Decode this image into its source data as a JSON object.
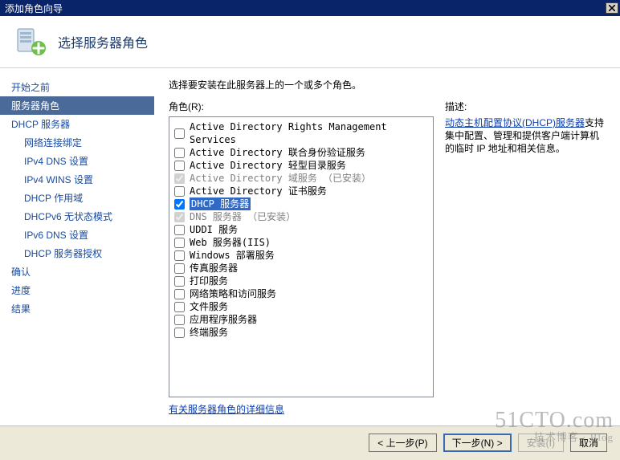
{
  "window": {
    "title": "添加角色向导"
  },
  "header": {
    "title": "选择服务器角色"
  },
  "sidebar": {
    "items": [
      {
        "label": "开始之前",
        "indent": false,
        "active": false
      },
      {
        "label": "服务器角色",
        "indent": false,
        "active": true
      },
      {
        "label": "DHCP 服务器",
        "indent": false,
        "active": false
      },
      {
        "label": "网络连接绑定",
        "indent": true,
        "active": false
      },
      {
        "label": "IPv4 DNS 设置",
        "indent": true,
        "active": false
      },
      {
        "label": "IPv4 WINS 设置",
        "indent": true,
        "active": false
      },
      {
        "label": "DHCP 作用域",
        "indent": true,
        "active": false
      },
      {
        "label": "DHCPv6 无状态模式",
        "indent": true,
        "active": false
      },
      {
        "label": "IPv6 DNS 设置",
        "indent": true,
        "active": false
      },
      {
        "label": "DHCP 服务器授权",
        "indent": true,
        "active": false
      },
      {
        "label": "确认",
        "indent": false,
        "active": false
      },
      {
        "label": "进度",
        "indent": false,
        "active": false
      },
      {
        "label": "结果",
        "indent": false,
        "active": false
      }
    ]
  },
  "main": {
    "instruction": "选择要安装在此服务器上的一个或多个角色。",
    "roles_label": "角色(R):",
    "roles": [
      {
        "label": "Active Directory Rights Management Services",
        "checked": false,
        "disabled": false,
        "selected": false
      },
      {
        "label": "Active Directory 联合身份验证服务",
        "checked": false,
        "disabled": false,
        "selected": false
      },
      {
        "label": "Active Directory 轻型目录服务",
        "checked": false,
        "disabled": false,
        "selected": false
      },
      {
        "label": "Active Directory 域服务 （已安装）",
        "checked": true,
        "disabled": true,
        "selected": false
      },
      {
        "label": "Active Directory 证书服务",
        "checked": false,
        "disabled": false,
        "selected": false
      },
      {
        "label": "DHCP 服务器",
        "checked": true,
        "disabled": false,
        "selected": true
      },
      {
        "label": "DNS 服务器 （已安装）",
        "checked": true,
        "disabled": true,
        "selected": false
      },
      {
        "label": "UDDI 服务",
        "checked": false,
        "disabled": false,
        "selected": false
      },
      {
        "label": "Web 服务器(IIS)",
        "checked": false,
        "disabled": false,
        "selected": false
      },
      {
        "label": "Windows 部署服务",
        "checked": false,
        "disabled": false,
        "selected": false
      },
      {
        "label": "传真服务器",
        "checked": false,
        "disabled": false,
        "selected": false
      },
      {
        "label": "打印服务",
        "checked": false,
        "disabled": false,
        "selected": false
      },
      {
        "label": "网络策略和访问服务",
        "checked": false,
        "disabled": false,
        "selected": false
      },
      {
        "label": "文件服务",
        "checked": false,
        "disabled": false,
        "selected": false
      },
      {
        "label": "应用程序服务器",
        "checked": false,
        "disabled": false,
        "selected": false
      },
      {
        "label": "终端服务",
        "checked": false,
        "disabled": false,
        "selected": false
      }
    ],
    "description_head": "描述:",
    "description_link": "动态主机配置协议(DHCP)服务器",
    "description_text": "支持集中配置、管理和提供客户端计算机的临时 IP 地址和相关信息。",
    "more_link": "有关服务器角色的详细信息"
  },
  "footer": {
    "back": "< 上一步(P)",
    "next": "下一步(N) >",
    "install": "安装(I)",
    "cancel": "取消"
  },
  "watermark": {
    "main": "51CTO.com",
    "sub": "技术博客 · Blog"
  }
}
